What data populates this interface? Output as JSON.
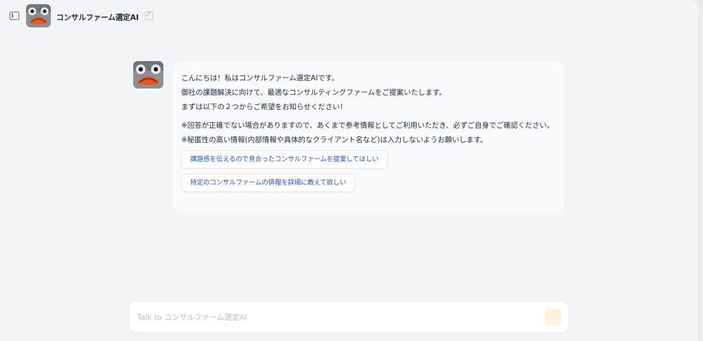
{
  "header": {
    "app_title": "コンサルファーム選定AI"
  },
  "message": {
    "line1": "こんにちは！私はコンサルファーム選定AIです。",
    "line2": "御社の課題解決に向けて、最適なコンサルティングファームをご提案いたします。",
    "line3": "まずは以下の２つからご希望をお知らせください！",
    "note1": "※回答が正確でない場合がありますので、あくまで参考情報としてご利用いただき、必ずご自身でご確認ください。",
    "note2": "※秘匿性の高い情報(内部情報や具体的なクライアント名など)は入力しないようお願いします。"
  },
  "suggestions": [
    "課題感を伝えるので見合ったコンサルファームを提案してほしい",
    "特定のコンサルファームの情報を詳細に教えて欲しい"
  ],
  "composer": {
    "placeholder": "Talk to コンサルファーム選定AI"
  },
  "icons": {
    "sidebar": "sidebar-toggle-icon",
    "edit": "edit-icon",
    "send": "send-icon"
  },
  "colors": {
    "link": "#1d4ed8",
    "background": "#f3f4f6"
  }
}
